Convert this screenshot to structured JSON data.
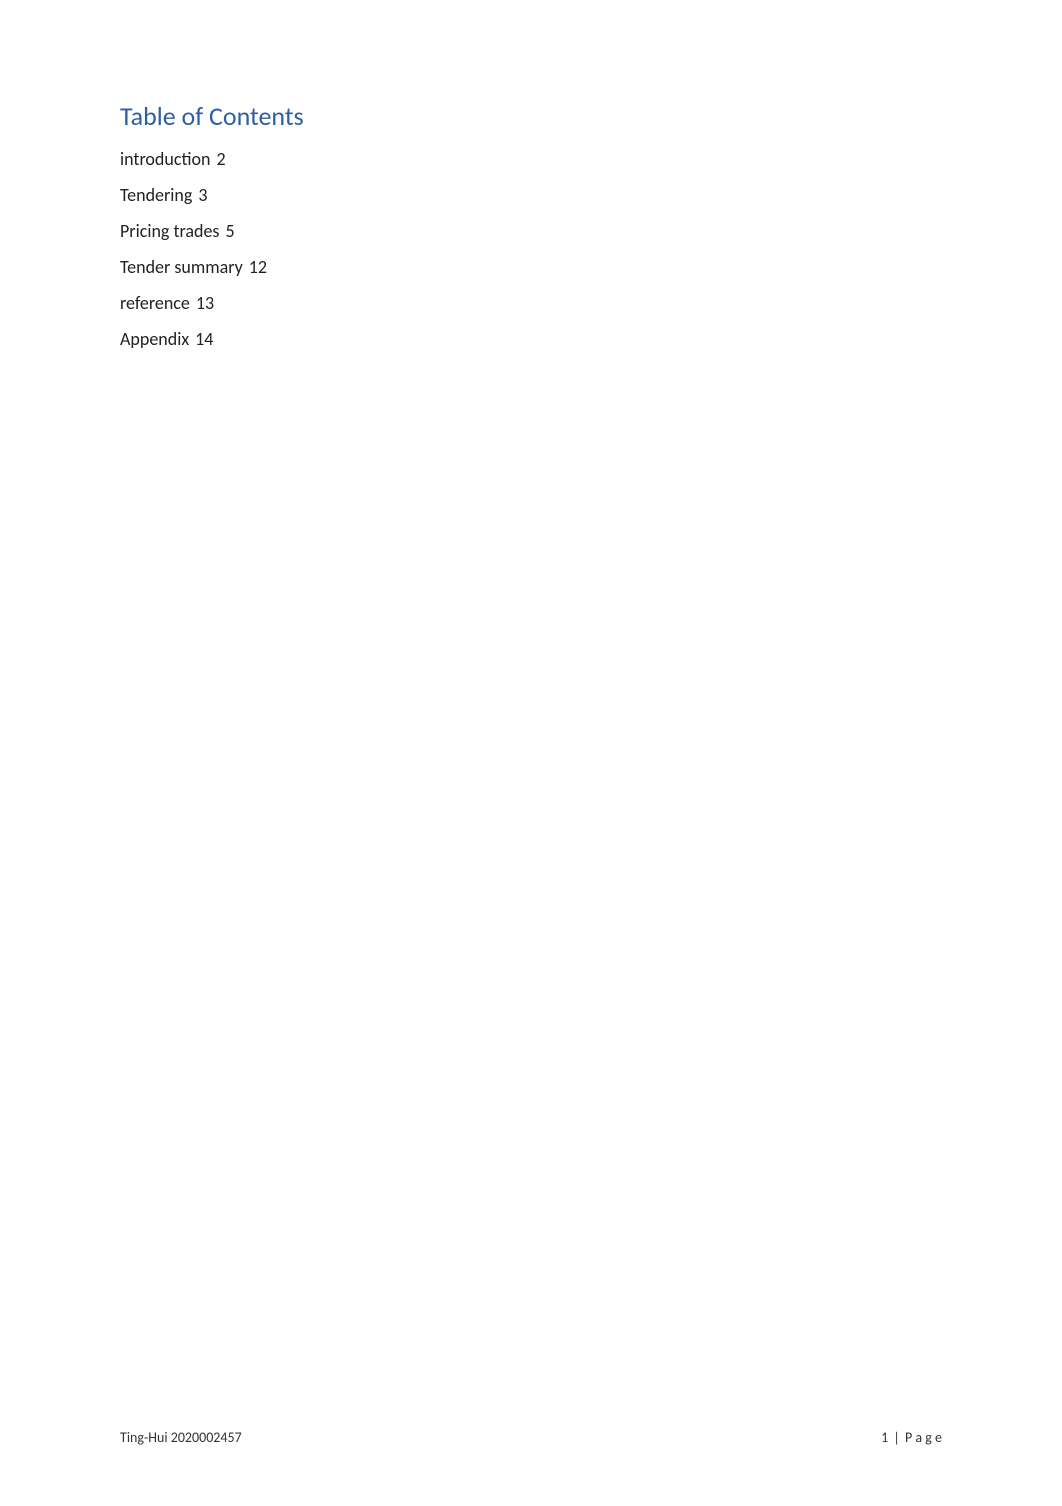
{
  "toc": {
    "title": "Table of Contents",
    "entries": [
      {
        "label": "introduction",
        "page": "2"
      },
      {
        "label": "Tendering",
        "page": "3"
      },
      {
        "label": "Pricing trades",
        "page": "5"
      },
      {
        "label": "Tender summary",
        "page": "12"
      },
      {
        "label": "reference",
        "page": "13"
      },
      {
        "label": "Appendix",
        "page": "14"
      }
    ]
  },
  "footer": {
    "left": "Ting-Hui 2020002457",
    "page_number": "1",
    "page_label": "P a g e"
  },
  "colors": {
    "toc_title": "#2e5fa3",
    "text": "#222222"
  }
}
